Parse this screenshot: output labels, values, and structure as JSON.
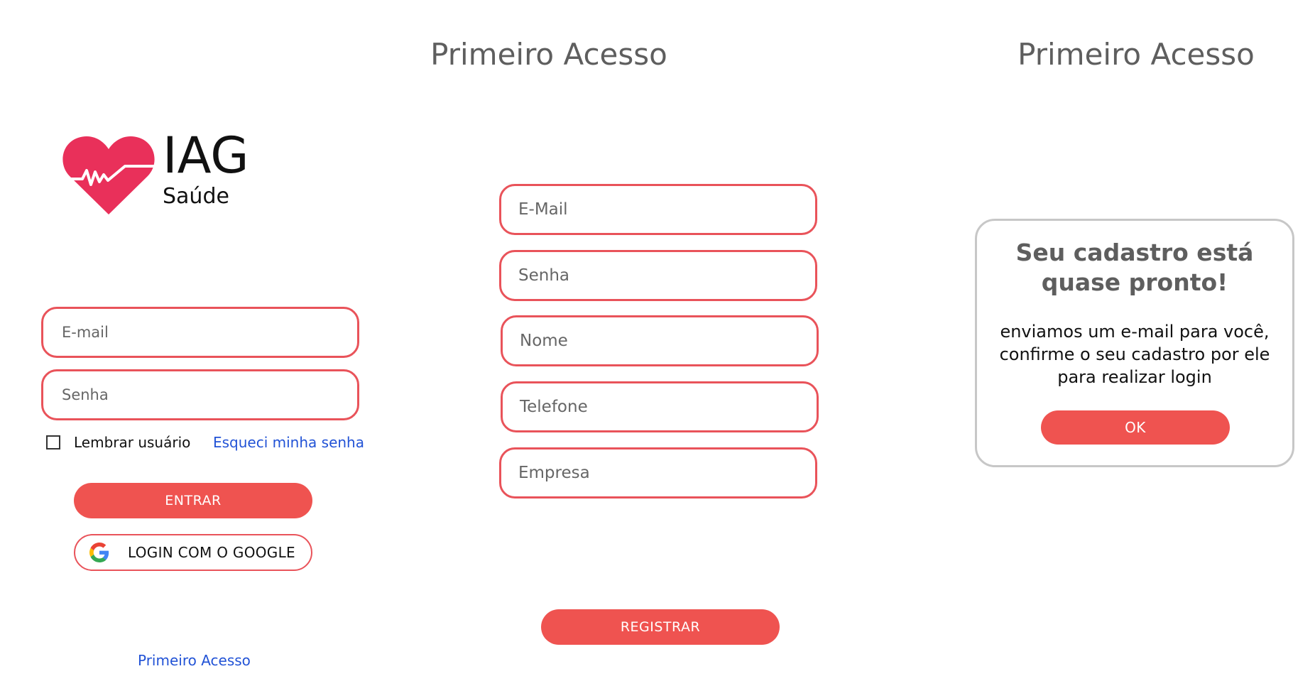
{
  "login": {
    "logo": {
      "title": "IAG",
      "subtitle": "Saúde"
    },
    "email_placeholder": "E-mail",
    "password_placeholder": "Senha",
    "remember_label": "Lembrar usuário",
    "forgot_link": "Esqueci minha senha",
    "enter_button": "ENTRAR",
    "google_button": "LOGIN COM O GOOGLE",
    "first_access_link": "Primeiro Acesso"
  },
  "register": {
    "title": "Primeiro Acesso",
    "fields": [
      "E-Mail",
      "Senha",
      "Nome",
      "Telefone",
      "Empresa"
    ],
    "register_button": "REGISTRAR"
  },
  "confirmation": {
    "title": "Primeiro Acesso",
    "dialog_heading": "Seu cadastro está\nquase pronto!",
    "dialog_message": "enviamos um e-mail para você,\nconfirme o seu cadastro por ele\npara realizar login",
    "ok_button": "OK"
  },
  "colors": {
    "accent": "#ef5350",
    "field_border": "#e9535a",
    "link": "#2253d6",
    "heart": "#e9305a",
    "dialog_border": "#c7c7c7"
  },
  "icons": [
    "heart-pulse-logo-icon",
    "google-icon",
    "checkbox-icon"
  ]
}
